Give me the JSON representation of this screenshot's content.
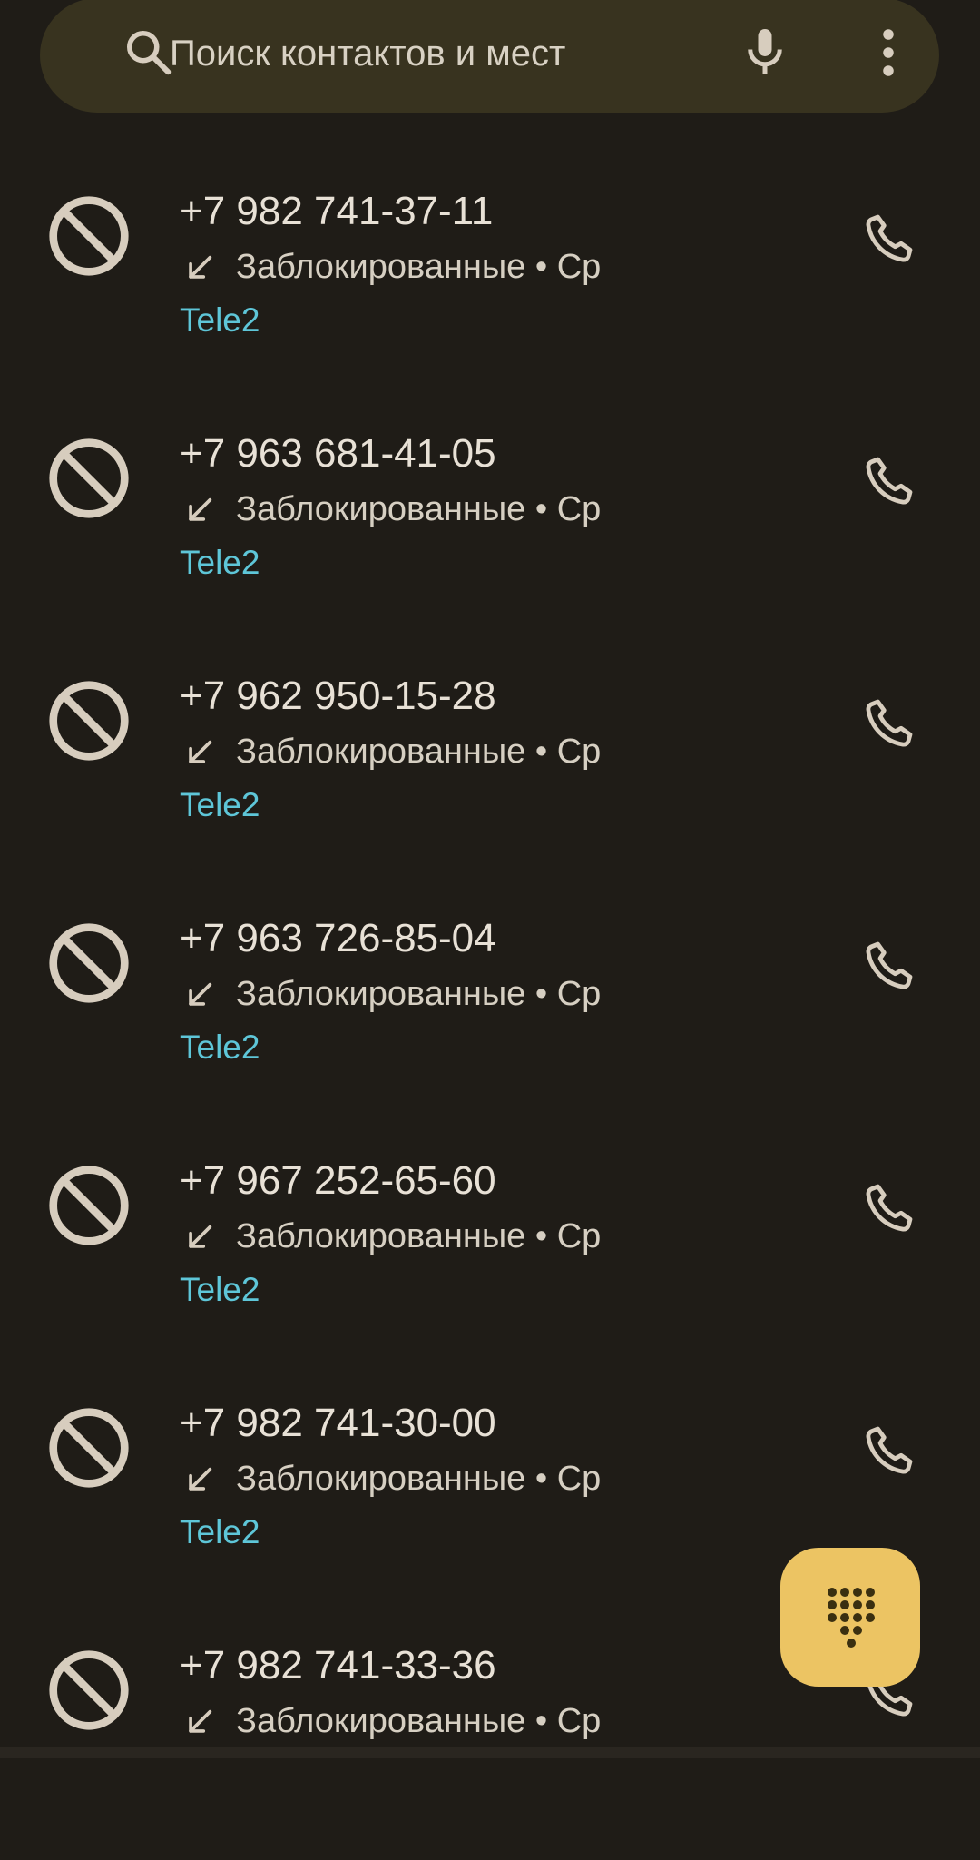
{
  "search": {
    "placeholder": "Поиск контактов и мест"
  },
  "icons": {
    "search": "search-icon",
    "mic": "mic-icon",
    "more": "more-vert-icon",
    "blocked": "block-icon",
    "incoming": "call-received-icon",
    "call": "phone-icon",
    "dialpad": "dialpad-icon"
  },
  "colors": {
    "background": "#1f1c17",
    "search_bar": "#38331f",
    "carrier": "#5ec6d8",
    "fab": "#ecc463",
    "icon": "#d7cdbe"
  },
  "calls": [
    {
      "number": "+7 982 741-37-11",
      "status": "Заблокированные • Ср",
      "carrier": "Tele2"
    },
    {
      "number": "+7 963 681-41-05",
      "status": "Заблокированные • Ср",
      "carrier": "Tele2"
    },
    {
      "number": "+7 962 950-15-28",
      "status": "Заблокированные • Ср",
      "carrier": "Tele2"
    },
    {
      "number": "+7 963 726-85-04",
      "status": "Заблокированные • Ср",
      "carrier": "Tele2"
    },
    {
      "number": "+7 967 252-65-60",
      "status": "Заблокированные • Ср",
      "carrier": "Tele2"
    },
    {
      "number": "+7 982 741-30-00",
      "status": "Заблокированные • Ср",
      "carrier": "Tele2"
    },
    {
      "number": "+7 982 741-33-36",
      "status": "Заблокированные • Ср",
      "carrier": ""
    }
  ]
}
